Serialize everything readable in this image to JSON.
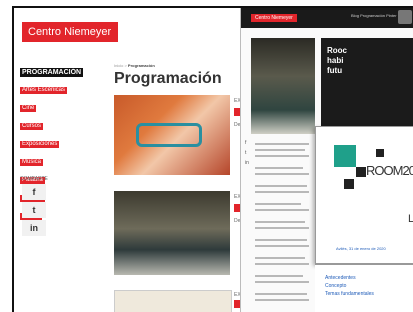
{
  "left_page": {
    "logo": "Centro Niemeyer",
    "breadcrumb_prefix": "Inicio >",
    "breadcrumb_current": "Programación",
    "title": "Programación",
    "sidebar": {
      "heading": "PROGRAMACIÓN",
      "items": [
        "Artes Escénicas",
        "Cine",
        "Cursos",
        "Exposiciones",
        "Música",
        "Palabra",
        "Talleres",
        "Visitas"
      ]
    },
    "share": {
      "label": "COMPARTE",
      "facebook": "f",
      "twitter": "t",
      "linkedin": "in"
    },
    "cards": [
      {
        "meta": "EXP",
        "cat": "De"
      },
      {
        "meta": "EXP",
        "cat": "De"
      },
      {
        "meta": "EXP",
        "cat": "De"
      }
    ]
  },
  "right_page": {
    "logo": "Centro Niemeyer",
    "nav": "Blog   Programación   Pinter",
    "hero_title": "Rooc\nhabi\nfutu",
    "card_brand": "ROOM20",
    "card_text": "La",
    "card_date": "Avilés, 31 de enero de 2020",
    "links": [
      "Antecedentes",
      "Concepto",
      "Temas fundamentales"
    ],
    "share_icons": [
      "f",
      "t",
      "in"
    ]
  }
}
